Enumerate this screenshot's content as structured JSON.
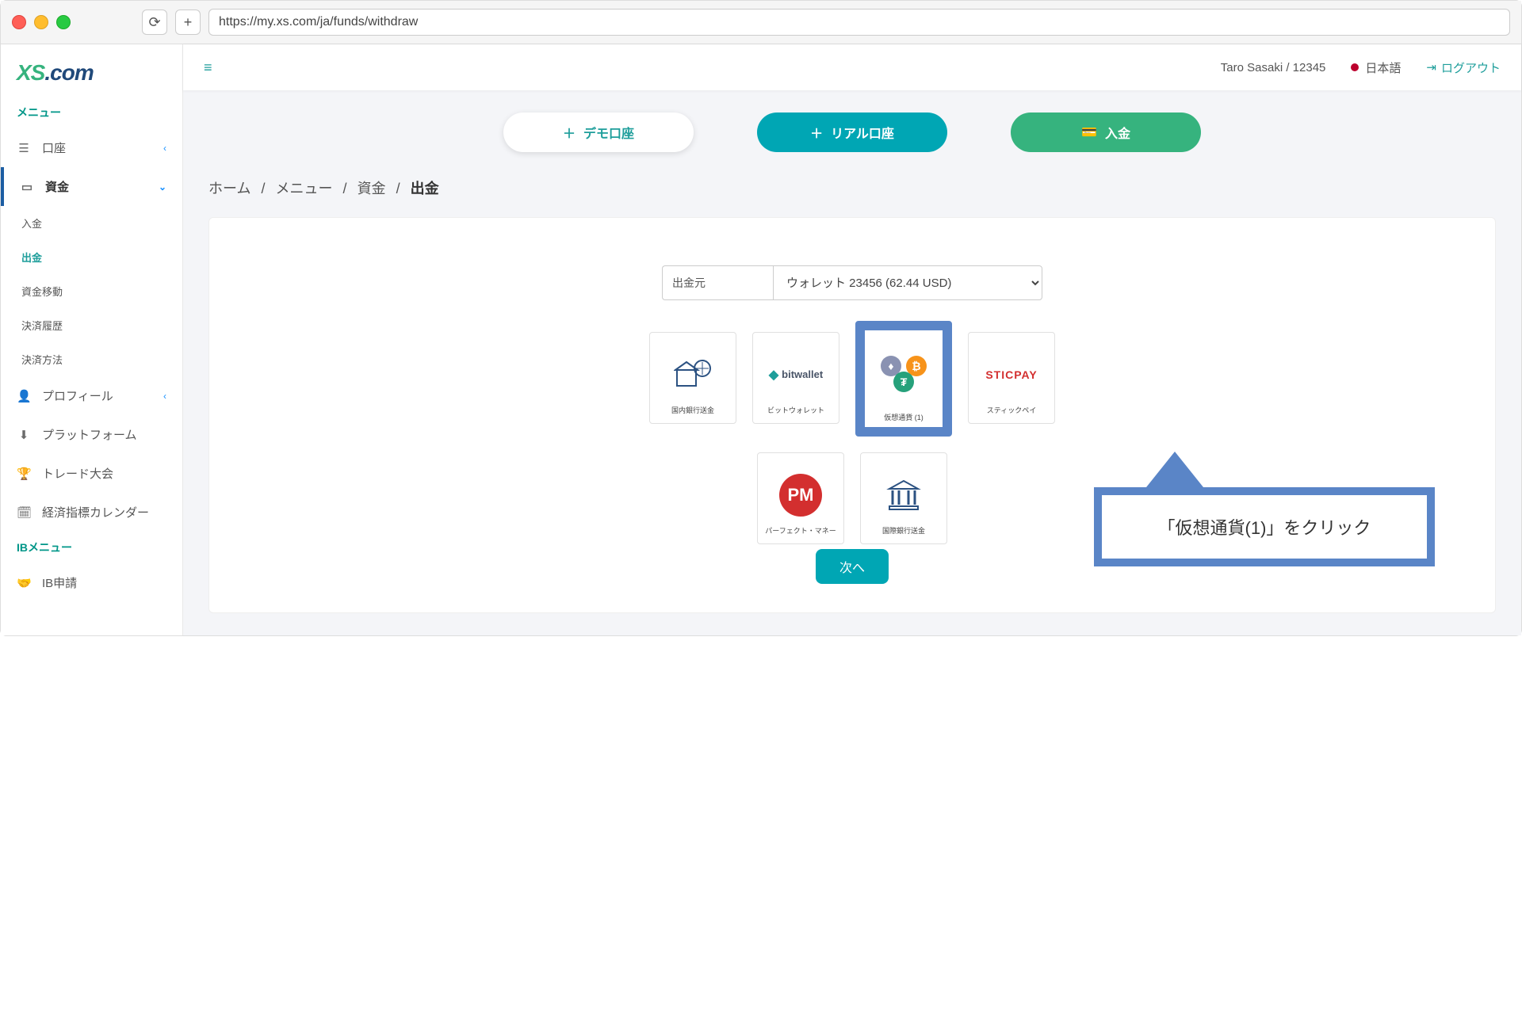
{
  "browser": {
    "url": "https://my.xs.com/ja/funds/withdraw"
  },
  "logo": {
    "part1": "XS",
    "part2": ".com"
  },
  "sidebar": {
    "menu_title": "メニュー",
    "ib_menu_title": "IBメニュー",
    "items": {
      "account": "口座",
      "funds": "資金",
      "profile": "プロフィール",
      "platform": "プラットフォーム",
      "trade_contest": "トレード大会",
      "economic_calendar": "経済指標カレンダー",
      "ib_apply": "IB申請"
    },
    "funds_sub": {
      "deposit": "入金",
      "withdraw": "出金",
      "transfer": "資金移動",
      "history": "決済履歴",
      "methods": "決済方法"
    }
  },
  "topbar": {
    "user": "Taro Sasaki / 12345",
    "language": "日本語",
    "logout": "ログアウト"
  },
  "actions": {
    "demo": "デモ口座",
    "real": "リアル口座",
    "deposit": "入金"
  },
  "breadcrumb": {
    "home": "ホーム",
    "menu": "メニュー",
    "funds": "資金",
    "withdraw": "出金"
  },
  "withdraw": {
    "source_label": "出金元",
    "source_value": "ウォレット 23456 (62.44 USD)",
    "methods": {
      "domestic_bank": "国内銀行送金",
      "bitwallet": "ビットウォレット",
      "crypto": "仮想通貨 (1)",
      "sticpay": "スティックペイ",
      "perfect_money": "パーフェクト・マネー",
      "international_bank": "国際銀行送金"
    },
    "next": "次へ"
  },
  "callout": {
    "text": "「仮想通貨(1)」をクリック"
  },
  "brands": {
    "bitwallet": "bitwallet",
    "sticpay": "STICPAY",
    "pm": "PM"
  }
}
